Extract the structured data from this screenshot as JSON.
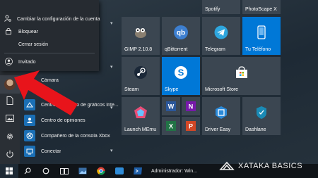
{
  "rail": {
    "icons": [
      "user-avatar",
      "document-icon",
      "pictures-icon",
      "settings-icon",
      "power-icon"
    ]
  },
  "popup": {
    "change_account": "Cambiar la configuración de la cuenta",
    "lock": "Bloquear",
    "sign_out": "Cerrar sesión",
    "guest": "Invitado"
  },
  "apps": [
    {
      "label": "Cámara"
    },
    {
      "label": "Centro de mando de gráficos Inte..."
    },
    {
      "label": "Centro de opiniones"
    },
    {
      "label": "Compañero de la consola Xbox"
    },
    {
      "label": "Conectar"
    }
  ],
  "tiles": {
    "spotify": "Spotify",
    "photoscape": "PhotoScape X",
    "gimp": "GIMP 2.10.8",
    "qbittorrent": "qBittorrent",
    "telegram": "Telegram",
    "tu_telefono": "Tu Teléfono",
    "steam": "Steam",
    "skype": "Skype",
    "ms_store": "Microsoft Store",
    "launch_memu": "Launch MEmu",
    "driver_easy": "Driver Easy",
    "dashlane": "Dashlane"
  },
  "taskbar": {
    "active_window": "Administrador: Win..."
  },
  "watermark": {
    "text": "XATAKA BASICS"
  },
  "colors": {
    "accent": "#0078d7",
    "arrow": "#e8141b",
    "tile_bg": "#3b4651"
  }
}
